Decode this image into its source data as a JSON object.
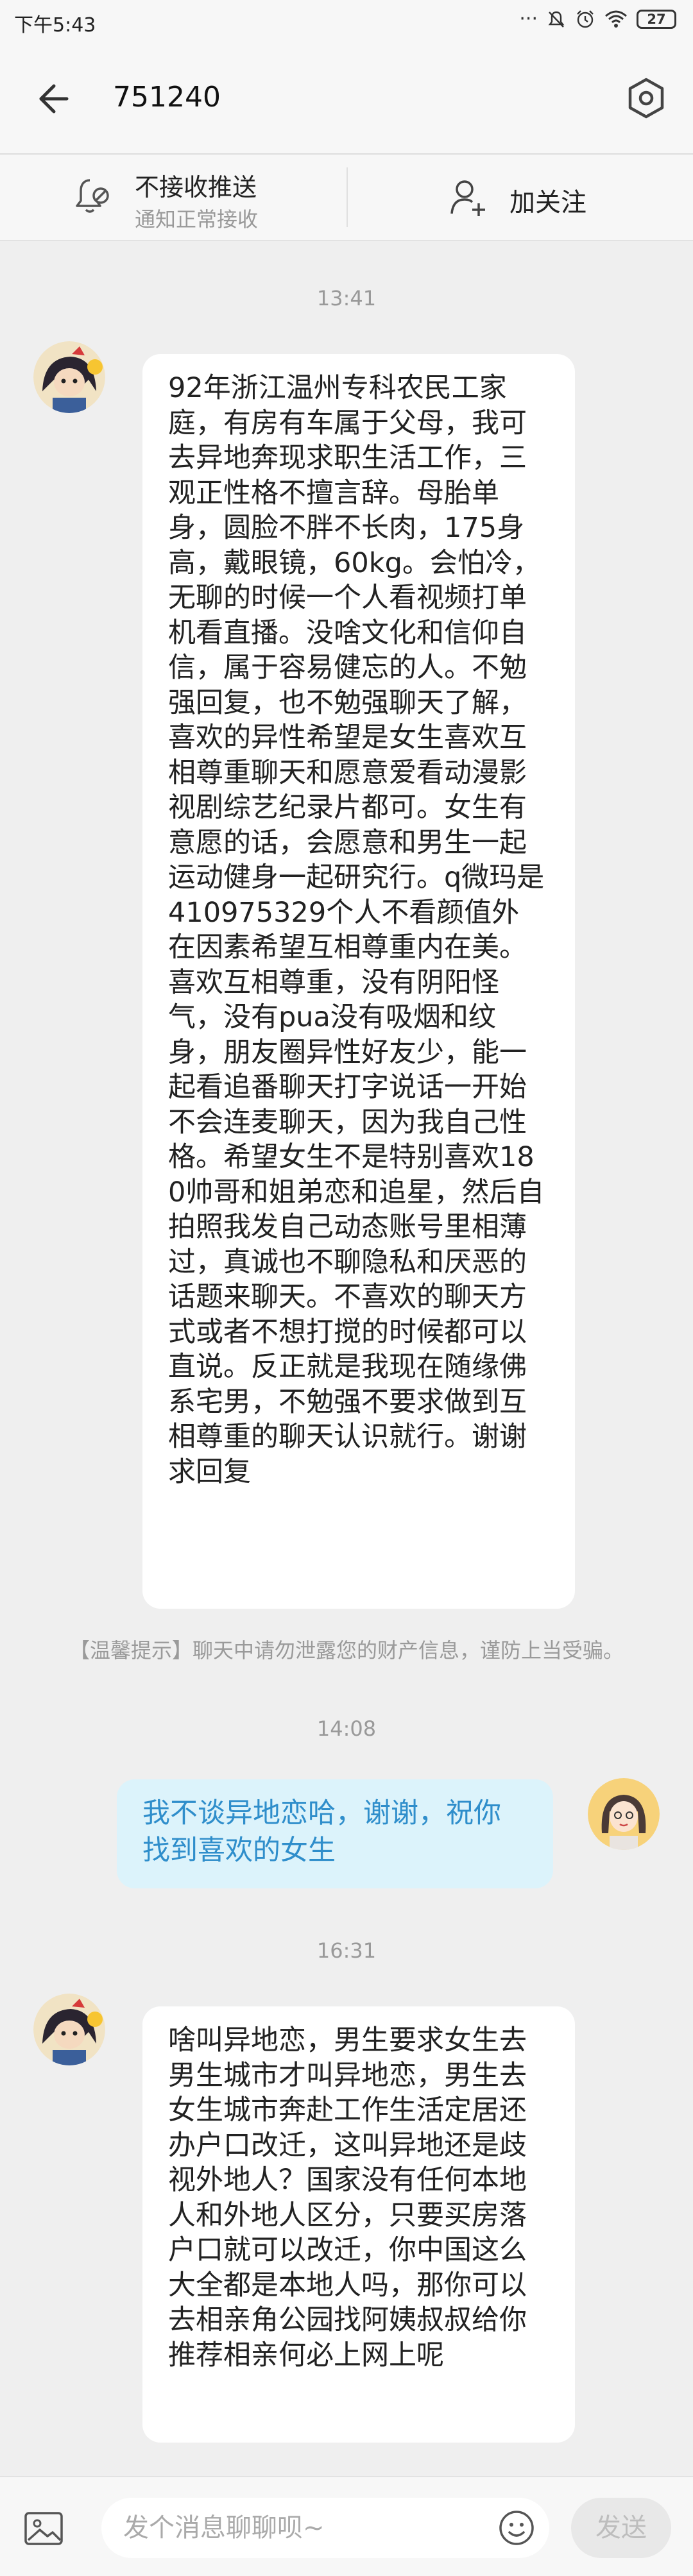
{
  "status_bar": {
    "time": "下午5:43",
    "icons": [
      "more-dots-icon",
      "mute-icon",
      "alarm-icon",
      "wifi-icon",
      "battery-icon"
    ],
    "dots": "···",
    "battery": "27"
  },
  "header": {
    "title": "751240"
  },
  "subscription": {
    "notify_title": "不接收推送",
    "notify_desc": "通知正常接收",
    "follow_label": "加关注"
  },
  "messages": [
    {
      "time": "13:41",
      "direction": "in",
      "text": "92年浙江温州专科农民工家庭，有房有车属于父母，我可去异地奔现求职生活工作，三观正性格不擅言辞。母胎单身，圆脸不胖不长肉，175身高，戴眼镜，60kg。会怕冷，无聊的时候一个人看视频打单机看直播。没啥文化和信仰自信，属于容易健忘的人。不勉强回复，也不勉强聊天了解，喜欢的异性希望是女生喜欢互相尊重聊天和愿意爱看动漫影视剧综艺纪录片都可。女生有意愿的话，会愿意和男生一起运动健身一起研究行。q微玛是410975329个人不看颜值外在因素希望互相尊重内在美。喜欢互相尊重，没有阴阳怪气，没有pua没有吸烟和纹身，朋友圈异性好友少，能一起看追番聊天打字说话一开始不会连麦聊天，因为我自己性格。希望女生不是特别喜欢180帅哥和姐弟恋和追星，然后自拍照我发自己动态账号里相薄过，真诚也不聊隐私和厌恶的话题来聊天。不喜欢的聊天方式或者不想打搅的时候都可以直说。反正就是我现在随缘佛系宅男，不勉强不要求做到互相尊重的聊天认识就行。谢谢求回复"
    },
    {
      "time": "14:08",
      "direction": "out",
      "text": "我不谈异地恋哈，谢谢，祝你找到喜欢的女生"
    },
    {
      "time": "16:31",
      "direction": "in",
      "text": "啥叫异地恋，男生要求女生去男生城市才叫异地恋，男生去女生城市奔赴工作生活定居还办户口改迁，这叫异地还是歧视外地人？国家没有任何本地人和外地人区分，只要买房落户口就可以改迁，你中国这么大全都是本地人吗，那你可以去相亲角公园找阿姨叔叔给你推荐相亲何必上网上呢"
    }
  ],
  "tip": "【温馨提示】聊天中请勿泄露您的财产信息，谨防上当受骗。",
  "input_bar": {
    "placeholder": "发个消息聊聊呗~",
    "send_label": "发送"
  }
}
